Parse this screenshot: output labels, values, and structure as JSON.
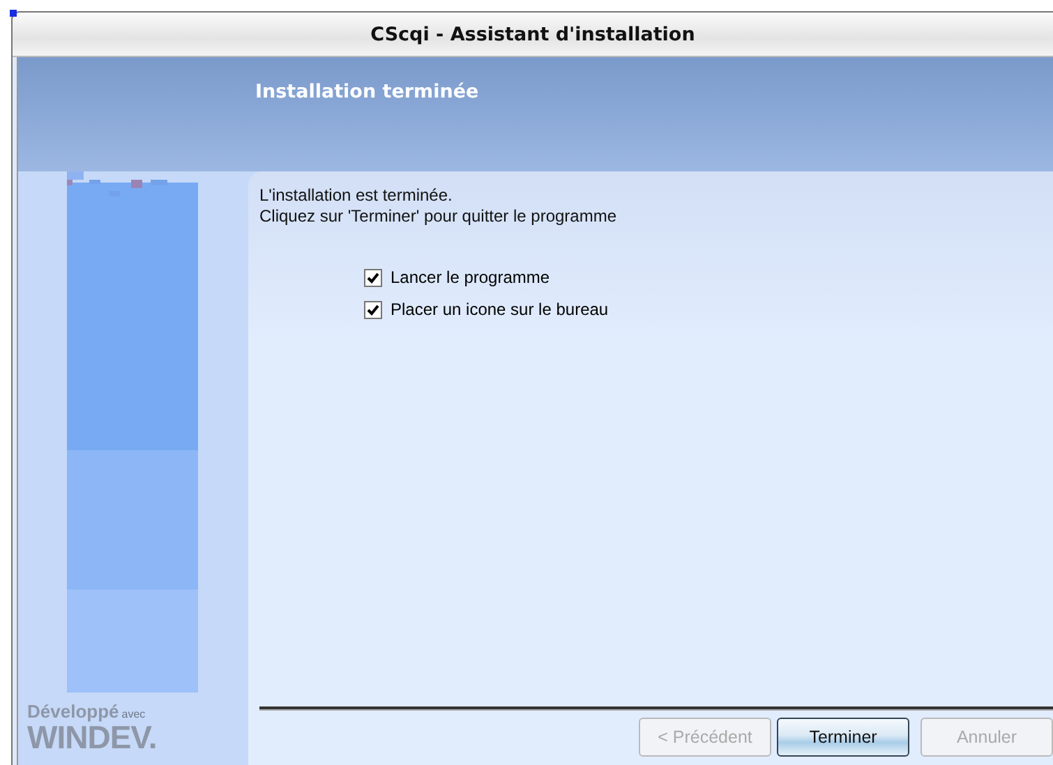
{
  "window": {
    "title": "CScqi - Assistant d'installation"
  },
  "header": {
    "title": "Installation terminée"
  },
  "sidebar": {
    "logo": {
      "line_1": "Développé",
      "line_1_small": "avec",
      "line_2": "WINDEV."
    }
  },
  "message": [
    "L'installation est terminée.",
    "Cliquez sur 'Terminer' pour quitter le programme"
  ],
  "options": [
    {
      "label": "Lancer le programme",
      "checked": true
    },
    {
      "label": "Placer un icone sur le bureau",
      "checked": true
    }
  ],
  "buttons": [
    {
      "label": "< Précédent",
      "disabled": true,
      "default": false
    },
    {
      "label": "Terminer",
      "disabled": false,
      "default": true
    },
    {
      "label": "Annuler",
      "disabled": true,
      "default": false
    }
  ]
}
